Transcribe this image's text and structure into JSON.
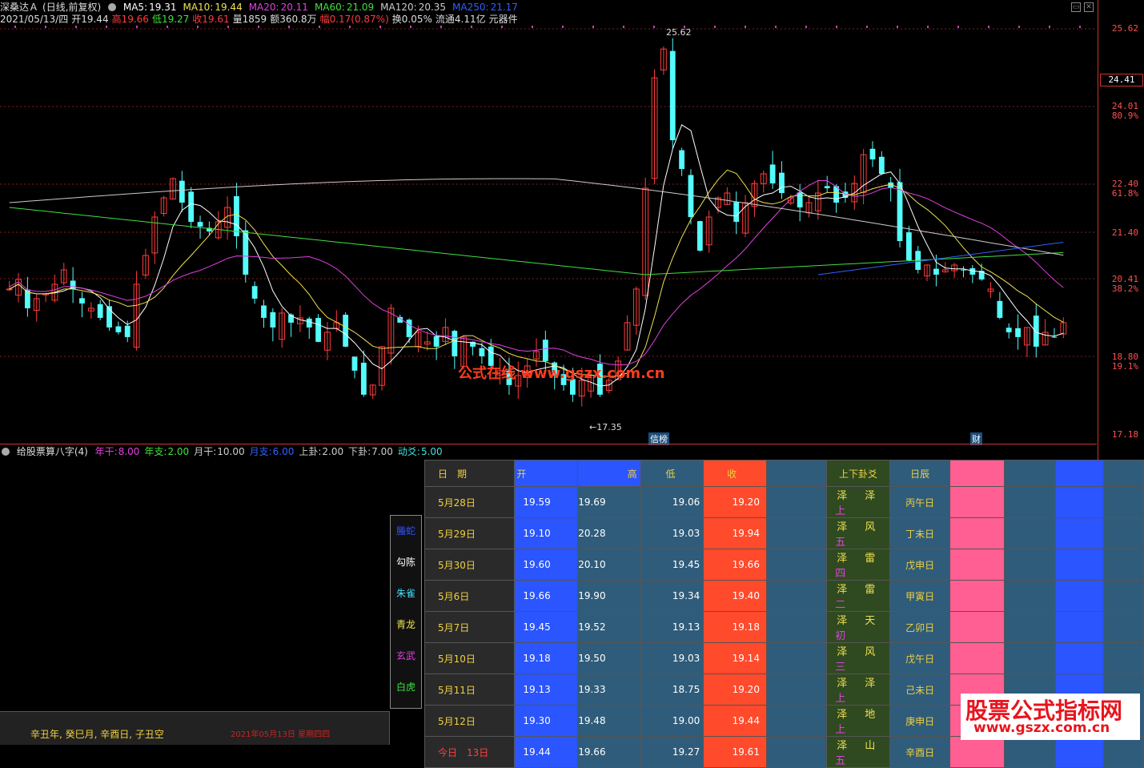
{
  "title": {
    "name": "深桑达Ａ",
    "mode": "(日线,前复权)"
  },
  "ma": [
    {
      "label": "MA5:",
      "value": "19.31",
      "color": "#ffffff"
    },
    {
      "label": "MA10:",
      "value": "19.44",
      "color": "#f0e050"
    },
    {
      "label": "MA20:",
      "value": "20.11",
      "color": "#e040e0"
    },
    {
      "label": "MA60:",
      "value": "21.09",
      "color": "#40e040"
    },
    {
      "label": "MA120:",
      "value": "20.35",
      "color": "#cccccc"
    },
    {
      "label": "MA250:",
      "value": "21.17",
      "color": "#3060ff"
    }
  ],
  "info": {
    "date": "2021/05/13/四",
    "open": "开19.44",
    "high": "高19.66",
    "low": "低19.27",
    "close": "收19.61",
    "vol": "量1859",
    "amount": "额360.8万",
    "chg": "幅0.17(0.87%)",
    "turnover": "换0.05%",
    "float": "流通4.11亿",
    "sector": "元器件"
  },
  "price_axis": {
    "ticks": [
      "25.62",
      "24.41",
      "24.01",
      "80.9%",
      "22.40",
      "61.8%",
      "21.40",
      "20.41",
      "38.2%",
      "18.80",
      "19.1%",
      "17.18"
    ],
    "current": "24.41"
  },
  "annotations": {
    "high": "25.62",
    "low": "17.35",
    "mark1": "信榜",
    "mark2": "财"
  },
  "watermark": "公式在线 www.gszx.com.cn",
  "indicator": {
    "name": "给股票算八字(4)",
    "params": [
      {
        "label": "年干:",
        "value": "8.00",
        "color": "#e040e0"
      },
      {
        "label": "年支:",
        "value": "2.00",
        "color": "#40e040"
      },
      {
        "label": "月干:",
        "value": "10.00",
        "color": "#cccccc"
      },
      {
        "label": "月支:",
        "value": "6.00",
        "color": "#3060ff"
      },
      {
        "label": "上卦:",
        "value": "2.00",
        "color": "#cccccc"
      },
      {
        "label": "下卦:",
        "value": "7.00",
        "color": "#cccccc"
      },
      {
        "label": "动爻:",
        "value": "5.00",
        "color": "#40e0e0"
      }
    ]
  },
  "gods": [
    {
      "label": "螣蛇",
      "color": "#3050ff"
    },
    {
      "label": "勾陈",
      "color": "#ffffff"
    },
    {
      "label": "朱雀",
      "color": "#40e0ff"
    },
    {
      "label": "青龙",
      "color": "#f0e050"
    },
    {
      "label": "玄武",
      "color": "#e040e0"
    },
    {
      "label": "白虎",
      "color": "#40e040"
    }
  ],
  "table": {
    "headers": {
      "date": "日　期",
      "open": "开",
      "high": "高",
      "low": "低",
      "close": "收",
      "gua": "上下卦爻",
      "day": "日辰"
    },
    "rows": [
      {
        "date": "5月28日",
        "open": "19.59",
        "high": "19.69",
        "low": "19.06",
        "close": "19.20",
        "g1": "泽",
        "g2": "泽",
        "g3": "上",
        "day": "丙午日"
      },
      {
        "date": "5月29日",
        "open": "19.10",
        "high": "20.28",
        "low": "19.03",
        "close": "19.94",
        "g1": "泽",
        "g2": "风",
        "g3": "五",
        "day": "丁未日"
      },
      {
        "date": "5月30日",
        "open": "19.60",
        "high": "20.10",
        "low": "19.45",
        "close": "19.66",
        "g1": "泽",
        "g2": "雷",
        "g3": "四",
        "day": "戊申日"
      },
      {
        "date": "5月6日",
        "open": "19.66",
        "high": "19.90",
        "low": "19.34",
        "close": "19.40",
        "g1": "泽",
        "g2": "雷",
        "g3": "二",
        "day": "甲寅日"
      },
      {
        "date": "5月7日",
        "open": "19.45",
        "high": "19.52",
        "low": "19.13",
        "close": "19.18",
        "g1": "泽",
        "g2": "天",
        "g3": "初",
        "day": "乙卯日"
      },
      {
        "date": "5月10日",
        "open": "19.18",
        "high": "19.50",
        "low": "19.03",
        "close": "19.14",
        "g1": "泽",
        "g2": "风",
        "g3": "三",
        "day": "戊午日"
      },
      {
        "date": "5月11日",
        "open": "19.13",
        "high": "19.33",
        "low": "18.75",
        "close": "19.20",
        "g1": "泽",
        "g2": "泽",
        "g3": "上",
        "day": "己未日"
      },
      {
        "date": "5月12日",
        "open": "19.30",
        "high": "19.48",
        "low": "19.00",
        "close": "19.44",
        "g1": "泽",
        "g2": "地",
        "g3": "上",
        "day": "庚申日"
      },
      {
        "date": "今日　13日",
        "open": "19.44",
        "high": "19.66",
        "low": "19.27",
        "close": "19.61",
        "g1": "泽",
        "g2": "山",
        "g3": "五",
        "day": "辛酉日"
      }
    ]
  },
  "status": {
    "ganzhi": "辛丑年, 癸巳月, 辛酉日, 子丑空",
    "datetime": "2021年05月13日 星期四四"
  },
  "brand": {
    "line1": "股票公式指标网",
    "line2": "www.gszx.com.cn"
  },
  "colors": {
    "up": "#ff3c3c",
    "down": "#54fcfc",
    "grid": "#8a1a1a",
    "axis": "#cc3333"
  },
  "icons": {
    "settings": "circle-icon",
    "minimize": "minimize-icon",
    "close": "close-icon"
  }
}
